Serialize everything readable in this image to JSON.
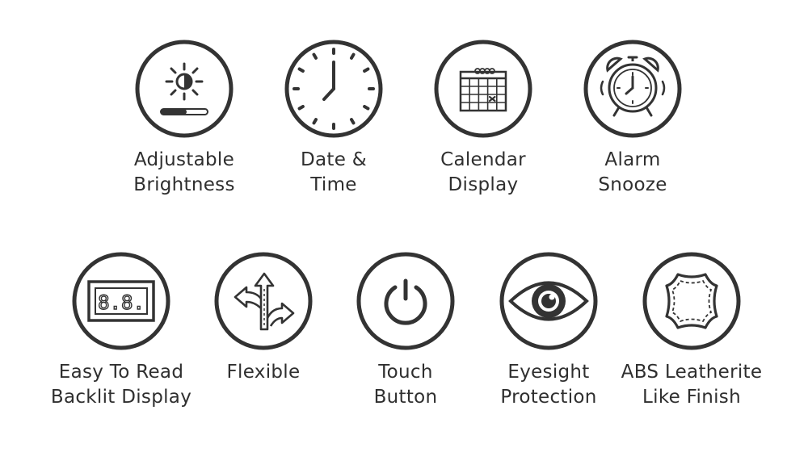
{
  "features": [
    {
      "id": "brightness",
      "icon": "brightness-icon",
      "line1": "Adjustable",
      "line2": "Brightness"
    },
    {
      "id": "datetime",
      "icon": "clock-icon",
      "line1": "Date &",
      "line2": "Time"
    },
    {
      "id": "calendar",
      "icon": "calendar-icon",
      "line1": "Calendar",
      "line2": "Display"
    },
    {
      "id": "alarm",
      "icon": "alarm-clock-icon",
      "line1": "Alarm",
      "line2": "Snooze"
    },
    {
      "id": "backlit",
      "icon": "digital-display-icon",
      "line1": "Easy To Read",
      "line2": "Backlit Display",
      "display_text": "8.8."
    },
    {
      "id": "flexible",
      "icon": "arrows-icon",
      "line1": "Flexible",
      "line2": ""
    },
    {
      "id": "touch",
      "icon": "power-icon",
      "line1": "Touch",
      "line2": "Button"
    },
    {
      "id": "eyesight",
      "icon": "eye-icon",
      "line1": "Eyesight",
      "line2": "Protection"
    },
    {
      "id": "leather",
      "icon": "leather-icon",
      "line1": "ABS Leatherite",
      "line2": "Like Finish"
    }
  ],
  "colors": {
    "stroke": "#333333",
    "text": "#2f2f2f",
    "background": "#ffffff"
  }
}
